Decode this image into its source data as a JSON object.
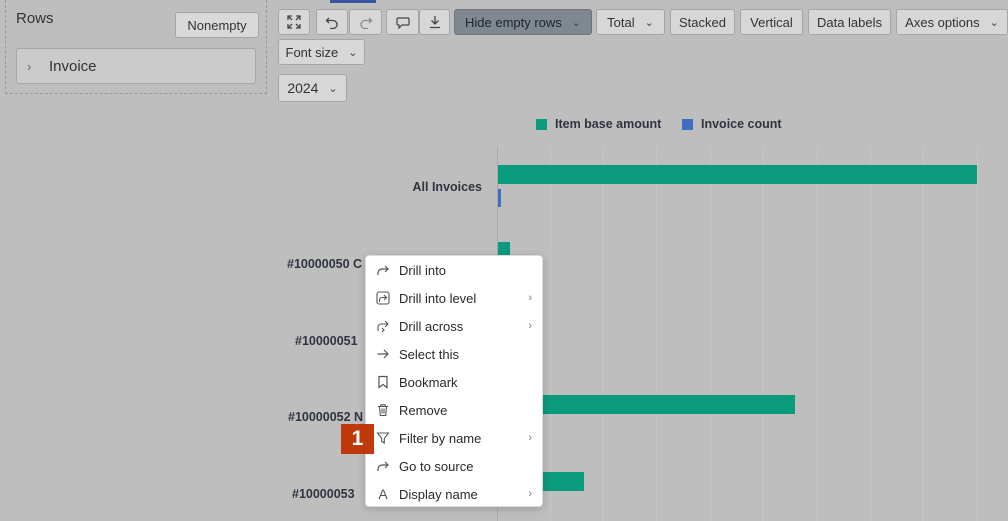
{
  "rows_panel": {
    "title": "Rows",
    "nonempty_label": "Nonempty",
    "chip_label": "Invoice"
  },
  "toolbar": {
    "hide_empty_rows": "Hide empty rows",
    "total": "Total",
    "stacked": "Stacked",
    "vertical": "Vertical",
    "data_labels": "Data labels",
    "axes_options": "Axes options",
    "font_size": "Font size",
    "year": "2024"
  },
  "legend": [
    {
      "label": "Item base amount",
      "color": "#0a9a7c"
    },
    {
      "label": "Invoice count",
      "color": "#3f6fc2"
    }
  ],
  "chart_data": {
    "type": "bar",
    "orientation": "horizontal",
    "categories": [
      "All Invoices",
      "#10000050 C",
      "#10000051",
      "#10000052 N",
      "#10000053"
    ],
    "series": [
      {
        "name": "Item base amount",
        "values": [
          100,
          2.5,
          0,
          62,
          18
        ]
      },
      {
        "name": "Invoice count",
        "values": [
          0.6,
          0,
          0,
          0,
          0
        ]
      }
    ],
    "grid": true,
    "legend_position": "top"
  },
  "context_menu": {
    "items": [
      {
        "label": "Drill into",
        "icon": "drill-icon",
        "submenu": false
      },
      {
        "label": "Drill into level",
        "icon": "drill-level-icon",
        "submenu": true
      },
      {
        "label": "Drill across",
        "icon": "drill-across-icon",
        "submenu": true
      },
      {
        "label": "Select this",
        "icon": "arrow-right-icon",
        "submenu": false
      },
      {
        "label": "Bookmark",
        "icon": "bookmark-icon",
        "submenu": false
      },
      {
        "label": "Remove",
        "icon": "trash-icon",
        "submenu": false
      },
      {
        "label": "Filter by name",
        "icon": "filter-icon",
        "submenu": true
      },
      {
        "label": "Go to source",
        "icon": "go-to-source-icon",
        "submenu": false
      },
      {
        "label": "Display name",
        "icon": "font-icon",
        "submenu": true
      }
    ]
  },
  "step_badge": "1"
}
